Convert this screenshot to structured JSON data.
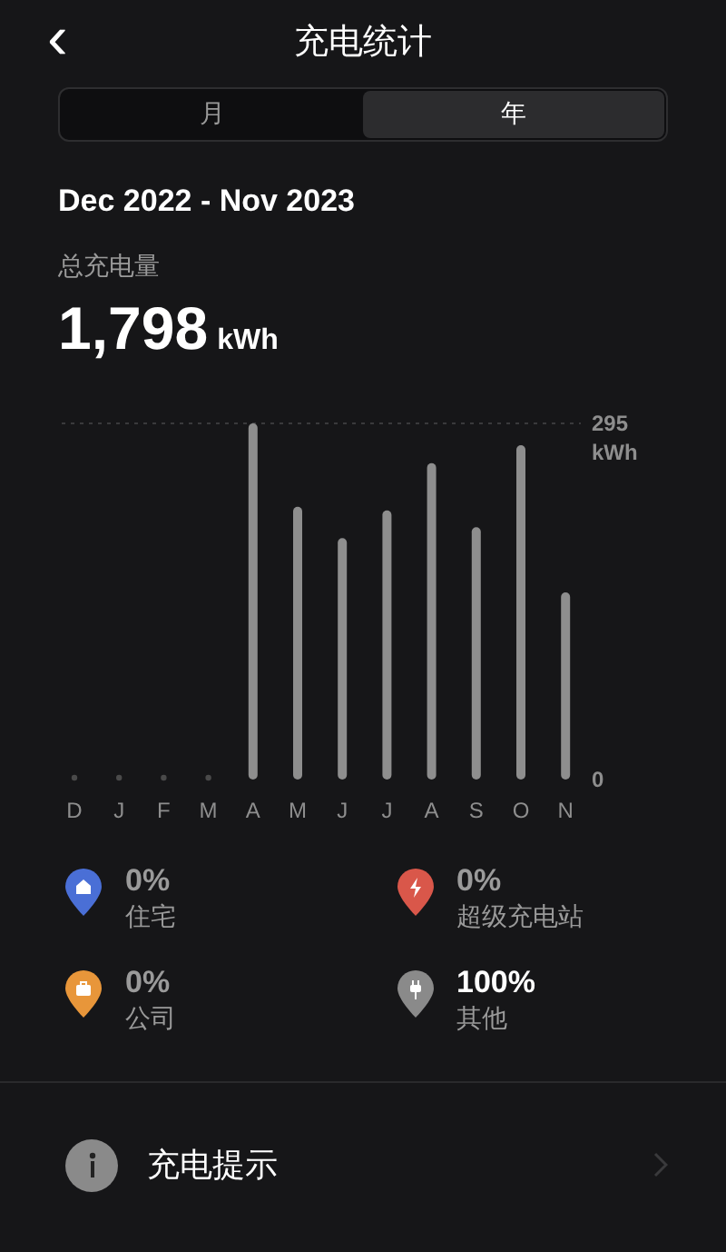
{
  "header": {
    "back": "‹",
    "title": "充电统计"
  },
  "tabs": [
    {
      "label": "月",
      "selected": false
    },
    {
      "label": "年",
      "selected": true
    }
  ],
  "period": "Dec 2022 - Nov 2023",
  "total": {
    "label": "总充电量",
    "value": "1,798",
    "unit": "kWh"
  },
  "chart_data": {
    "type": "bar",
    "categories": [
      "D",
      "J",
      "F",
      "M",
      "A",
      "M",
      "J",
      "J",
      "A",
      "S",
      "O",
      "N"
    ],
    "series": [
      {
        "color": "#8e8e8e",
        "values": [
          0,
          0,
          0,
          0,
          295,
          226,
          200,
          223,
          262,
          209,
          277,
          155
        ]
      }
    ],
    "ylabel": "kWh",
    "ylim": [
      0,
      295
    ],
    "yticks": [
      0,
      295
    ]
  },
  "locations": [
    {
      "kind": "home",
      "color": "#4a6fd6",
      "percent": "0%",
      "label": "住宅",
      "highlight": false
    },
    {
      "kind": "supercharger",
      "color": "#d9574a",
      "percent": "0%",
      "label": "超级充电站",
      "highlight": false
    },
    {
      "kind": "work",
      "color": "#e8963a",
      "percent": "0%",
      "label": "公司",
      "highlight": false
    },
    {
      "kind": "other",
      "color": "#8a8a8a",
      "percent": "100%",
      "label": "其他",
      "highlight": true
    }
  ],
  "tip_row": {
    "label": "充电提示"
  }
}
